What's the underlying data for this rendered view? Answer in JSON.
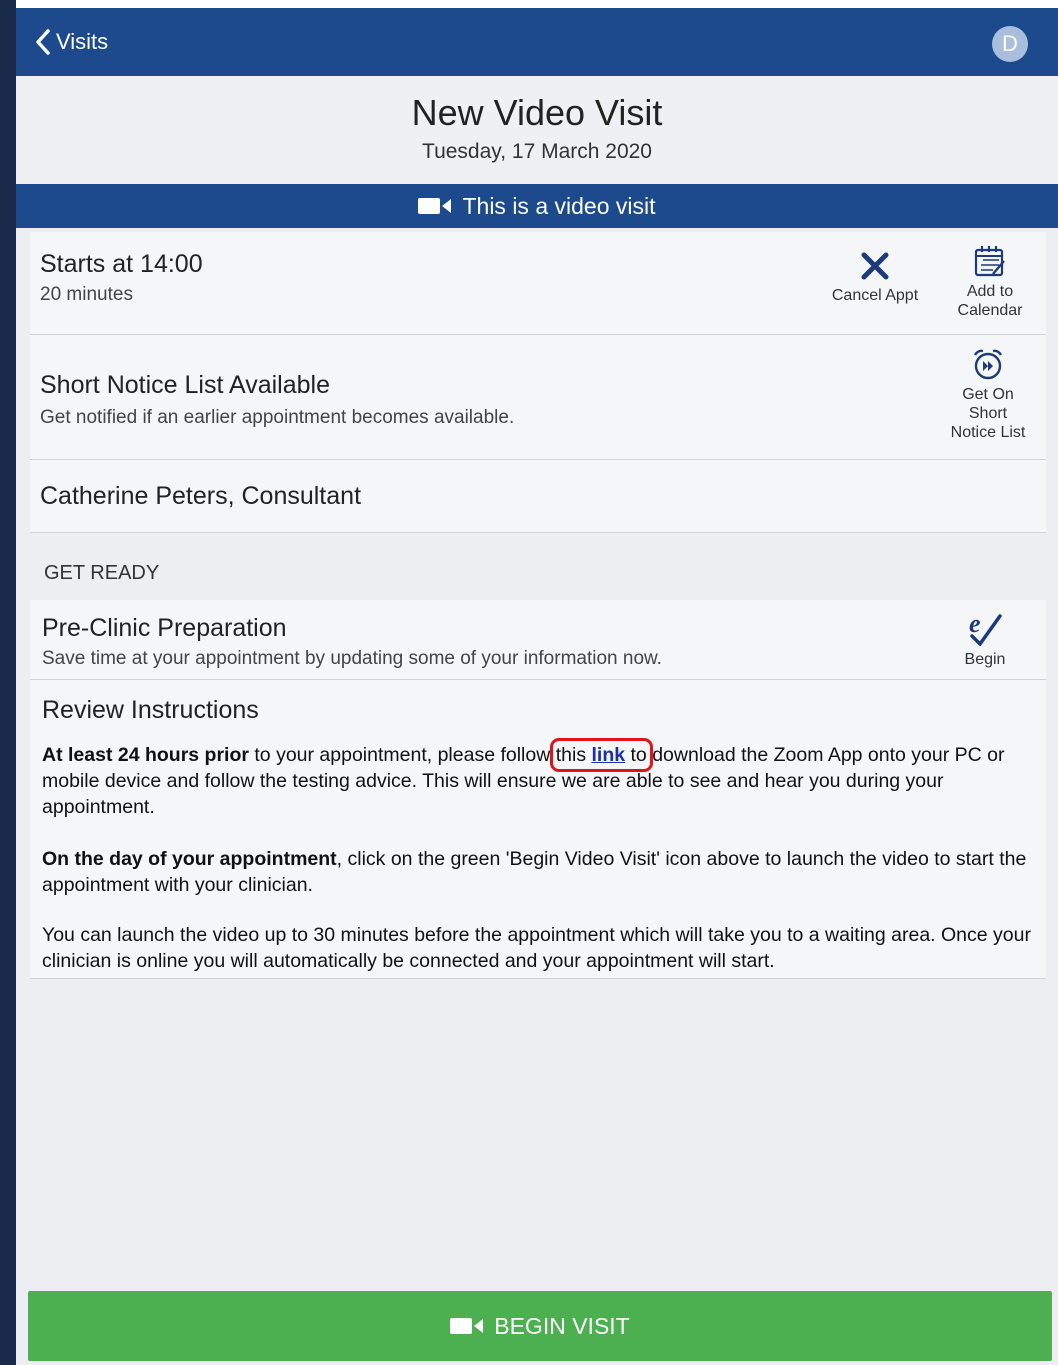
{
  "nav": {
    "back_label": "Visits",
    "avatar_initial": "D"
  },
  "header": {
    "title": "New Video Visit",
    "date": "Tuesday, 17 March 2020"
  },
  "banner": {
    "text": "This is a video visit"
  },
  "appointment": {
    "starts": "Starts at 14:00",
    "duration": "20 minutes",
    "cancel_label": "Cancel Appt",
    "calendar_label_1": "Add to",
    "calendar_label_2": "Calendar"
  },
  "short_notice": {
    "title": "Short Notice List Available",
    "subtitle": "Get notified if an earlier appointment becomes available.",
    "action_1": "Get On",
    "action_2": "Short",
    "action_3": "Notice List"
  },
  "clinician": {
    "name": "Catherine Peters, Consultant"
  },
  "get_ready": {
    "label": "GET READY",
    "preclinic_title": "Pre-Clinic Preparation",
    "preclinic_sub": "Save time at your appointment by updating some of your information now.",
    "begin_label": "Begin"
  },
  "instructions": {
    "title": "Review Instructions",
    "p1_bold": "At least 24 hours prior",
    "p1_a": " to your appointment, please follow ",
    "p1_this": "this ",
    "p1_link": "link",
    "p1_to": " to",
    "p1_b": " download the Zoom App onto your PC or mobile device and follow the testing advice. This will ensure we are able to see and hear you during your appointment.",
    "p2_bold": "On the day of your appointment",
    "p2_rest": ", click on the green 'Begin Video Visit' icon above to launch the video to start the appointment with your clinician.",
    "p3": "You can launch the video up to 30 minutes before the appointment which will take you to a waiting area. Once your clinician is online you will automatically be connected and your appointment will start."
  },
  "footer": {
    "begin_visit": "BEGIN VISIT"
  },
  "colors": {
    "nav_blue": "#1d4a8c",
    "begin_green": "#4caf50",
    "highlight_red": "#e0141a",
    "link_blue": "#1a2fa8"
  }
}
